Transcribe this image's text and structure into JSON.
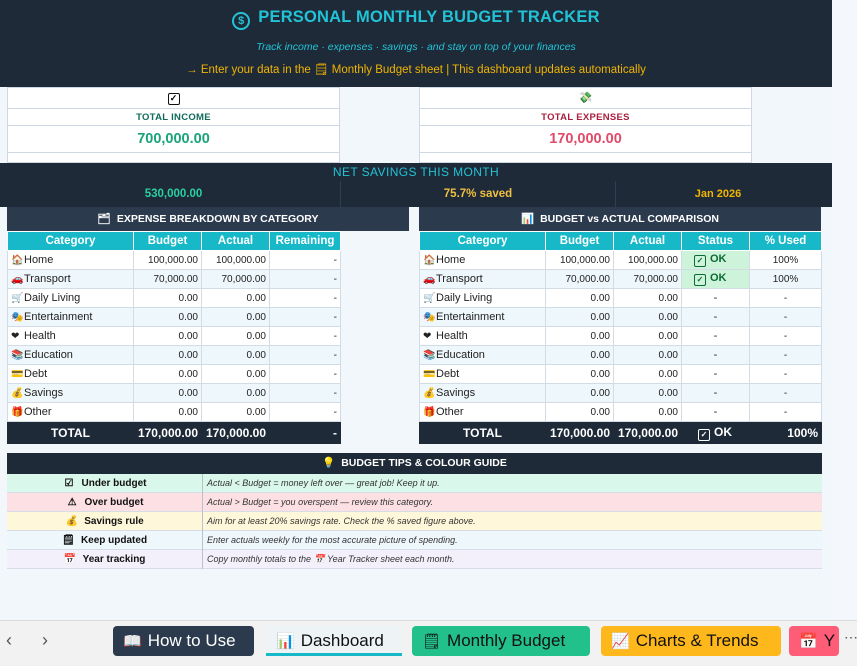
{
  "header": {
    "title": "PERSONAL MONTHLY BUDGET TRACKER",
    "subtitle": "Track income · expenses · savings · and stay on top of your finances",
    "instruction": "→ Enter your data in the  🗒 Monthly Budget  sheet  |  This dashboard updates automatically"
  },
  "kpis": {
    "income": {
      "label": "TOTAL INCOME",
      "value": "700,000.00",
      "color": "#1aa37a"
    },
    "expenses": {
      "label": "TOTAL EXPENSES",
      "value": "170,000.00",
      "color": "#e04b6a"
    }
  },
  "net": {
    "title": "NET SAVINGS THIS MONTH",
    "amount": "530,000.00",
    "percent": "75.7% saved",
    "month": "Jan 2026"
  },
  "breakdown": {
    "title": "EXPENSE BREAKDOWN BY CATEGORY",
    "headers": [
      "Category",
      "Budget",
      "Actual",
      "Remaining"
    ],
    "rows": [
      {
        "icon": "🏠",
        "category": "Home",
        "budget": "100,000.00",
        "actual": "100,000.00",
        "remaining": "-"
      },
      {
        "icon": "🚗",
        "category": "Transport",
        "budget": "70,000.00",
        "actual": "70,000.00",
        "remaining": "-"
      },
      {
        "icon": "🛒",
        "category": "Daily Living",
        "budget": "0.00",
        "actual": "0.00",
        "remaining": "-"
      },
      {
        "icon": "🎭",
        "category": "Entertainment",
        "budget": "0.00",
        "actual": "0.00",
        "remaining": "-"
      },
      {
        "icon": "❤",
        "category": "Health",
        "budget": "0.00",
        "actual": "0.00",
        "remaining": "-"
      },
      {
        "icon": "📚",
        "category": "Education",
        "budget": "0.00",
        "actual": "0.00",
        "remaining": "-"
      },
      {
        "icon": "💳",
        "category": "Debt",
        "budget": "0.00",
        "actual": "0.00",
        "remaining": "-"
      },
      {
        "icon": "💰",
        "category": "Savings",
        "budget": "0.00",
        "actual": "0.00",
        "remaining": "-"
      },
      {
        "icon": "🎁",
        "category": "Other",
        "budget": "0.00",
        "actual": "0.00",
        "remaining": "-"
      }
    ],
    "total": {
      "label": "TOTAL",
      "budget": "170,000.00",
      "actual": "170,000.00",
      "remaining": "-"
    }
  },
  "comparison": {
    "title": "BUDGET vs ACTUAL COMPARISON",
    "headers": [
      "Category",
      "Budget",
      "Actual",
      "Status",
      "% Used"
    ],
    "rows": [
      {
        "icon": "🏠",
        "category": "Home",
        "budget": "100,000.00",
        "actual": "100,000.00",
        "status": "OK",
        "used": "100%"
      },
      {
        "icon": "🚗",
        "category": "Transport",
        "budget": "70,000.00",
        "actual": "70,000.00",
        "status": "OK",
        "used": "100%"
      },
      {
        "icon": "🛒",
        "category": "Daily Living",
        "budget": "0.00",
        "actual": "0.00",
        "status": "-",
        "used": "-"
      },
      {
        "icon": "🎭",
        "category": "Entertainment",
        "budget": "0.00",
        "actual": "0.00",
        "status": "-",
        "used": "-"
      },
      {
        "icon": "❤",
        "category": "Health",
        "budget": "0.00",
        "actual": "0.00",
        "status": "-",
        "used": "-"
      },
      {
        "icon": "📚",
        "category": "Education",
        "budget": "0.00",
        "actual": "0.00",
        "status": "-",
        "used": "-"
      },
      {
        "icon": "💳",
        "category": "Debt",
        "budget": "0.00",
        "actual": "0.00",
        "status": "-",
        "used": "-"
      },
      {
        "icon": "💰",
        "category": "Savings",
        "budget": "0.00",
        "actual": "0.00",
        "status": "-",
        "used": "-"
      },
      {
        "icon": "🎁",
        "category": "Other",
        "budget": "0.00",
        "actual": "0.00",
        "status": "-",
        "used": "-"
      }
    ],
    "total": {
      "label": "TOTAL",
      "budget": "170,000.00",
      "actual": "170,000.00",
      "status": "OK",
      "used": "100%"
    }
  },
  "tips": {
    "title": "BUDGET TIPS & COLOUR GUIDE",
    "rows": [
      {
        "icon": "☑",
        "label": "Under budget",
        "text": "Actual < Budget = money left over — great job! Keep it up.",
        "bg": "#d9f7ea"
      },
      {
        "icon": "⚠",
        "label": "Over budget",
        "text": "Actual > Budget = you overspent — review this category.",
        "bg": "#fde0e4"
      },
      {
        "icon": "💰",
        "label": "Savings rule",
        "text": "Aim for at least 20% savings rate. Check the % saved figure above.",
        "bg": "#fff7d9"
      },
      {
        "icon": "🗒",
        "label": "Keep updated",
        "text": "Enter actuals weekly for the most accurate picture of spending.",
        "bg": "#eef7fb"
      },
      {
        "icon": "📅",
        "label": "Year tracking",
        "text": "Copy monthly totals to the 📅 Year Tracker sheet each month.",
        "bg": "#f3f0fb"
      }
    ]
  },
  "sheets": {
    "tabs": [
      {
        "icon": "📖",
        "label": "How to Use"
      },
      {
        "icon": "📊",
        "label": "Dashboard"
      },
      {
        "icon": "🗒",
        "label": "Monthly Budget"
      },
      {
        "icon": "📈",
        "label": "Charts & Trends"
      },
      {
        "icon": "📅",
        "label": "Y"
      }
    ],
    "more": "⋯"
  }
}
